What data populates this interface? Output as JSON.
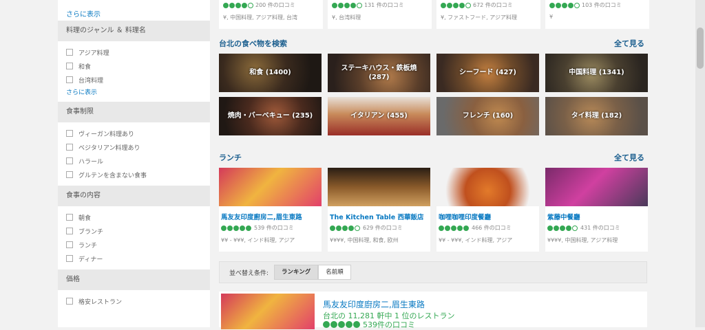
{
  "sidebar": {
    "top_more": "さらに表示",
    "sections": [
      {
        "title": "料理のジャンル ＆ 料理名",
        "items": [
          "アジア料理",
          "和食",
          "台湾料理"
        ],
        "more": "さらに表示"
      },
      {
        "title": "食事制限",
        "items": [
          "ヴィーガン料理あり",
          "ベジタリアン料理あり",
          "ハラール",
          "グルテンを含まない食事"
        ]
      },
      {
        "title": "食事の内容",
        "items": [
          "朝食",
          "ブランチ",
          "ランチ",
          "ディナー"
        ]
      },
      {
        "title": "価格",
        "items": [
          "格安レストラン"
        ]
      }
    ]
  },
  "top_cards": [
    {
      "reviews": "200 件の口コミ",
      "info": "¥, 中国料理, アジア料理, 台湾"
    },
    {
      "reviews": "131 件の口コミ",
      "info": "¥, 台湾料理"
    },
    {
      "reviews": "672 件の口コミ",
      "info": "¥, ファストフード, アジア料理"
    },
    {
      "reviews": "103 件の口コミ",
      "info": "¥"
    }
  ],
  "search_section": {
    "title": "台北の食べ物を検索",
    "see_all": "全て見る",
    "tiles": [
      "和食 (1400)",
      "ステーキハウス・鉄板焼 (287)",
      "シーフード (427)",
      "中国料理 (1341)",
      "焼肉・バーベキュー (235)",
      "イタリアン (455)",
      "フレンチ (160)",
      "タイ料理 (182)"
    ]
  },
  "lunch_section": {
    "title": "ランチ",
    "see_all": "全て見る",
    "cards": [
      {
        "name": "馬友友印度廚房二,眉生東路",
        "reviews": "539 件の口コミ",
        "info": "¥¥ - ¥¥¥, インド料理, アジア"
      },
      {
        "name": "The Kitchen Table 西華飯店",
        "reviews": "629 件の口コミ",
        "info": "¥¥¥¥, 中国料理, 和食, 欧州"
      },
      {
        "name": "咖哩咖哩印度餐廳",
        "reviews": "466 件の口コミ",
        "info": "¥¥ - ¥¥¥, インド料理, アジア"
      },
      {
        "name": "紫藤中餐廳",
        "reviews": "431 件の口コミ",
        "info": "¥¥¥¥, 中国料理, アジア料理"
      }
    ]
  },
  "sort_bar": {
    "label": "並べ替え条件:",
    "options": [
      "ランキング",
      "名前順"
    ]
  },
  "result": {
    "name": "馬友友印度廚房二,眉生東路",
    "rank": "台北の 11,281 軒中 1 位のレストラン",
    "reviews": "539件の口コミ"
  },
  "colors": {
    "link": "#0a7ac2",
    "rating": "#34a853",
    "section_title": "#1a5e8e"
  }
}
